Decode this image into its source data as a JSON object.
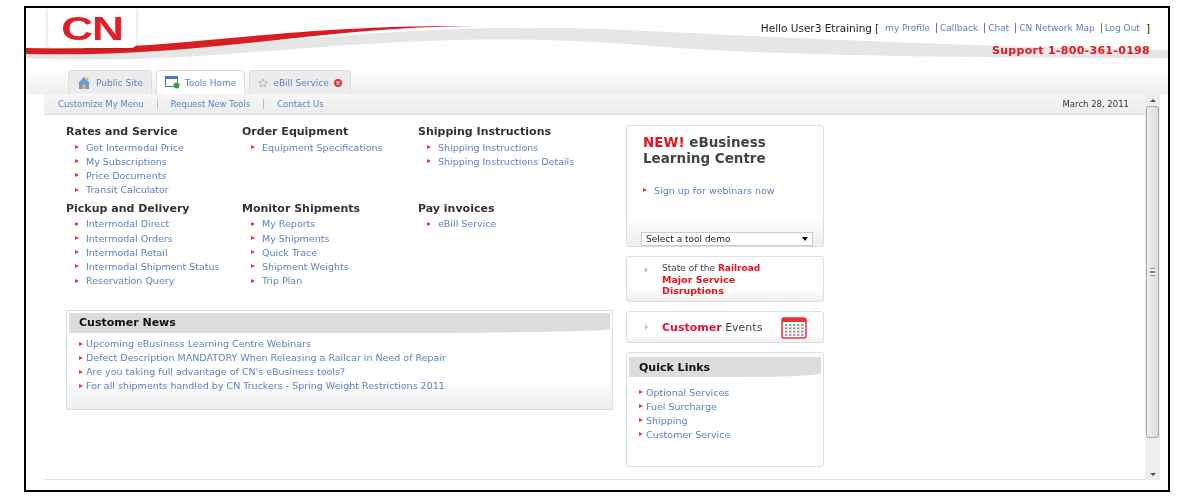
{
  "logo": {
    "text": "CN"
  },
  "user_bar": {
    "greeting": "Hello User3 Etraining",
    "open_bracket": "[",
    "links": [
      "my Profile",
      "Callback",
      "Chat",
      "CN Network Map",
      "Log Out"
    ],
    "close_bracket": "]"
  },
  "support": "Support 1-800-361-0198",
  "tabs": [
    {
      "label": "Public Site",
      "selected": false,
      "kind": "house",
      "closable": false
    },
    {
      "label": "Tools Home",
      "selected": true,
      "kind": "window",
      "closable": false
    },
    {
      "label": "eBill Service",
      "selected": false,
      "kind": "star",
      "closable": true
    }
  ],
  "sub_nav": {
    "links": [
      "Customize My Menu",
      "Request New Tools",
      "Contact Us"
    ],
    "date": "March 28, 2011"
  },
  "menu_groups": [
    {
      "title": "Rates and Service",
      "links": [
        "Get Intermodal Price",
        "My Subscriptions",
        "Price Documents",
        "Transit Calculator"
      ]
    },
    {
      "title": "Order Equipment",
      "links": [
        "Equipment Specifications"
      ]
    },
    {
      "title": "Shipping Instructions",
      "links": [
        "Shipping Instructions",
        "Shipping Instructions Details"
      ]
    },
    {
      "title": "Pickup and Delivery",
      "links": [
        "Intermodal Direct",
        "Intermodal Orders",
        "Intermodal Retail",
        "Intermodal Shipment Status",
        "Reservation Query"
      ]
    },
    {
      "title": "Monitor Shipments",
      "links": [
        "My Reports",
        "My Shipments",
        "Quick Trace",
        "Shipment Weights",
        "Trip Plan"
      ]
    },
    {
      "title": "Pay invoices",
      "links": [
        "eBill Service"
      ]
    }
  ],
  "customer_news": {
    "title": "Customer News",
    "items": [
      "Upcoming eBusiness Learning Centre Webinars",
      "Defect Description MANDATORY When Releasing a Railcar in Need of Repair",
      "Are you taking full advantage of CN's eBusiness tools?",
      "For all shipments handled by CN Truckers - Spring Weight Restrictions 2011"
    ]
  },
  "learning_centre": {
    "highlight": "NEW!",
    "title": "eBusiness Learning Centre",
    "link": "Sign up for webinars now",
    "select": {
      "value": "Select a tool demo"
    }
  },
  "railroad": {
    "prefix": "State of the",
    "highlight": "Railroad",
    "subtitle": "Major Service Disruptions"
  },
  "events": {
    "highlight": "Customer",
    "title": "Events"
  },
  "quick_links": {
    "title": "Quick Links",
    "links": [
      "Optional Services",
      "Fuel Surcharge",
      "Shipping",
      "Customer Service"
    ]
  }
}
